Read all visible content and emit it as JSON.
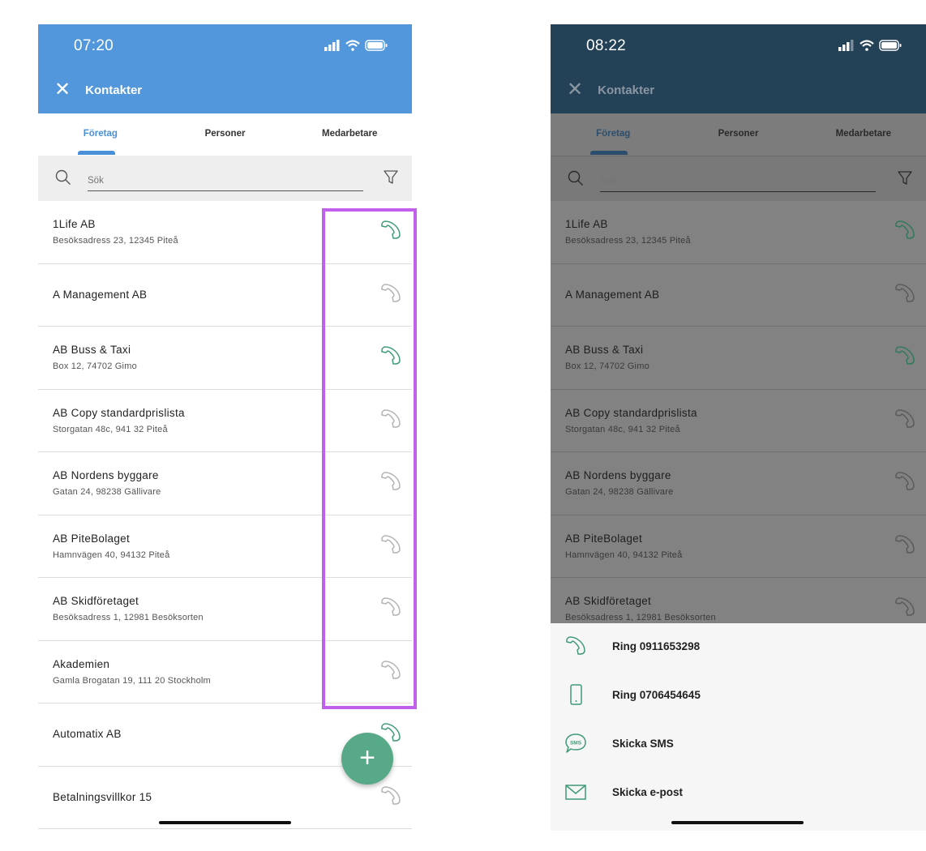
{
  "left": {
    "time": "07:20",
    "title": "Kontakter",
    "tabs": [
      {
        "label": "Företag"
      },
      {
        "label": "Personer"
      },
      {
        "label": "Medarbetare"
      }
    ],
    "search_placeholder": "Sök",
    "contacts": [
      {
        "name": "1Life AB",
        "address": "Besöksadress 23, 12345 Piteå",
        "phone_active": true
      },
      {
        "name": "A Management AB",
        "address": "",
        "phone_active": false
      },
      {
        "name": "AB Buss & Taxi",
        "address": "Box 12, 74702 Gimo",
        "phone_active": true
      },
      {
        "name": "AB Copy standardprislista",
        "address": "Storgatan 48c, 941 32 Piteå",
        "phone_active": false
      },
      {
        "name": "AB Nordens byggare",
        "address": "Gatan 24, 98238 Gällivare",
        "phone_active": false
      },
      {
        "name": "AB PiteBolaget",
        "address": "Hamnvägen 40, 94132 Piteå",
        "phone_active": false
      },
      {
        "name": "AB Skidföretaget",
        "address": "Besöksadress 1, 12981 Besöksorten",
        "phone_active": false
      },
      {
        "name": "Akademien",
        "address": "Gamla Brogatan 19, 111 20 Stockholm",
        "phone_active": false
      },
      {
        "name": "Automatix AB",
        "address": "",
        "phone_active": true
      },
      {
        "name": "Betalningsvillkor 15",
        "address": "",
        "phone_active": false
      }
    ],
    "fab_label": "+"
  },
  "right": {
    "time": "08:22",
    "title": "Kontakter",
    "tabs": [
      {
        "label": "Företag"
      },
      {
        "label": "Personer"
      },
      {
        "label": "Medarbetare"
      }
    ],
    "search_placeholder": "Sök",
    "contacts": [
      {
        "name": "1Life AB",
        "address": "Besöksadress 23, 12345 Piteå",
        "phone_active": true
      },
      {
        "name": "A Management AB",
        "address": "",
        "phone_active": false
      },
      {
        "name": "AB Buss & Taxi",
        "address": "Box 12, 74702 Gimo",
        "phone_active": true
      },
      {
        "name": "AB Copy standardprislista",
        "address": "Storgatan 48c, 941 32 Piteå",
        "phone_active": false
      },
      {
        "name": "AB Nordens byggare",
        "address": "Gatan 24, 98238 Gällivare",
        "phone_active": false
      },
      {
        "name": "AB PiteBolaget",
        "address": "Hamnvägen 40, 94132 Piteå",
        "phone_active": false
      },
      {
        "name": "AB Skidföretaget",
        "address": "Besöksadress 1, 12981 Besöksorten",
        "phone_active": false
      }
    ],
    "sheet_actions": [
      {
        "label": "Ring 0911653298",
        "icon": "phone-icon"
      },
      {
        "label": "Ring 0706454645",
        "icon": "mobile-icon"
      },
      {
        "label": "Skicka SMS",
        "icon": "sms-icon"
      },
      {
        "label": "Skicka e-post",
        "icon": "mail-icon"
      }
    ]
  },
  "colors": {
    "left_header": "#5296dc",
    "right_header": "#234157",
    "accent_blue": "#4a90d9",
    "phone_green": "#3f9a76",
    "phone_gray": "#b3b3b3",
    "highlight": "#c160ec",
    "fab": "#58a987"
  }
}
